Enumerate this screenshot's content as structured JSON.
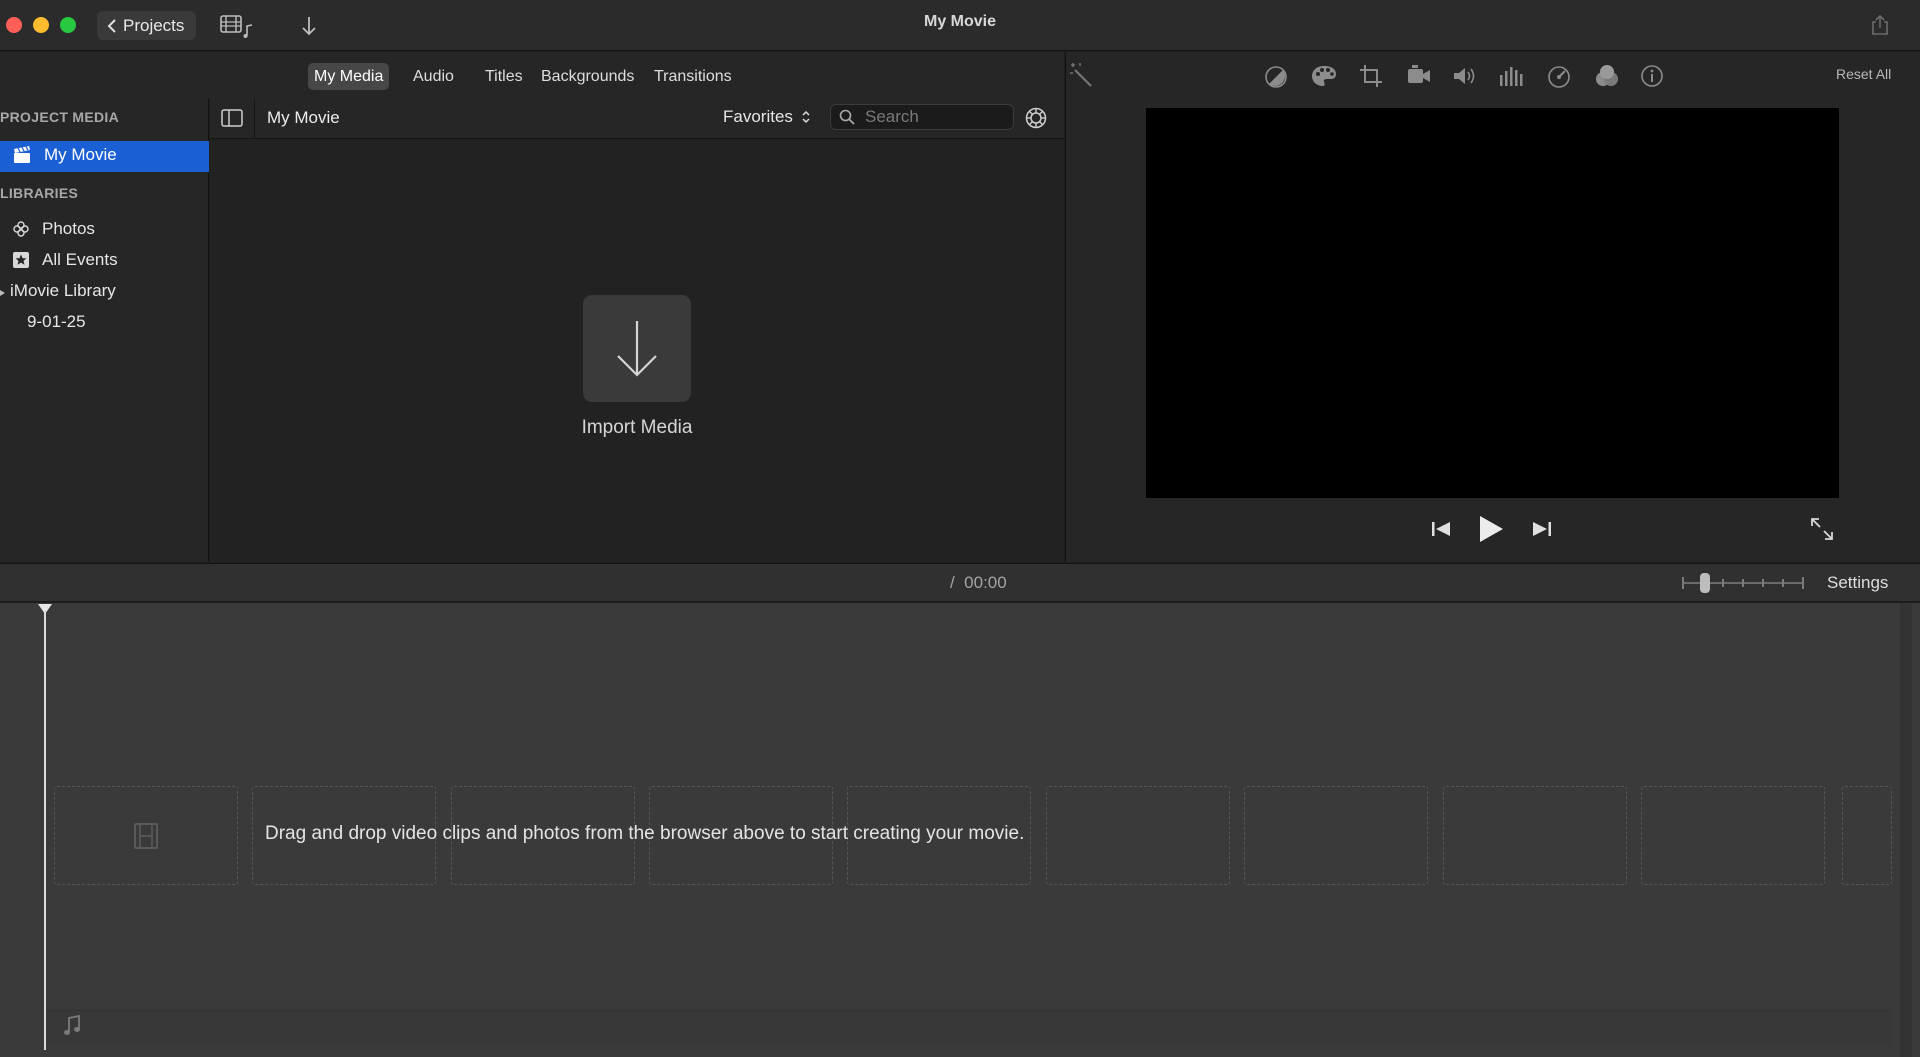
{
  "window": {
    "title": "My Movie",
    "back_button": "Projects"
  },
  "media_tabs": [
    "My Media",
    "Audio",
    "Titles",
    "Backgrounds",
    "Transitions"
  ],
  "sidebar": {
    "project_media_title": "PROJECT MEDIA",
    "project_item": "My Movie",
    "libraries_title": "LIBRARIES",
    "library_items": [
      "Photos",
      "All Events"
    ],
    "library_name": "iMovie Library",
    "event_name": "9-01-25"
  },
  "browser": {
    "title": "My Movie",
    "filter": "Favorites",
    "search_placeholder": "Search",
    "import_label": "Import Media"
  },
  "viewer": {
    "reset_all": "Reset All",
    "tool_icons": [
      "color-balance-icon",
      "color-palette-icon",
      "crop-icon",
      "stabilization-icon",
      "volume-icon",
      "equalizer-icon",
      "speed-icon",
      "filter-icon",
      "info-icon"
    ]
  },
  "timeline": {
    "timecode": "/  00:00",
    "settings_label": "Settings",
    "drop_hint": "Drag and drop video clips and photos from the browser above to start creating your movie."
  },
  "colors": {
    "accent": "#1a5fd4",
    "close": "#ff5f57",
    "minimize": "#febc2e",
    "zoom": "#28c840"
  }
}
